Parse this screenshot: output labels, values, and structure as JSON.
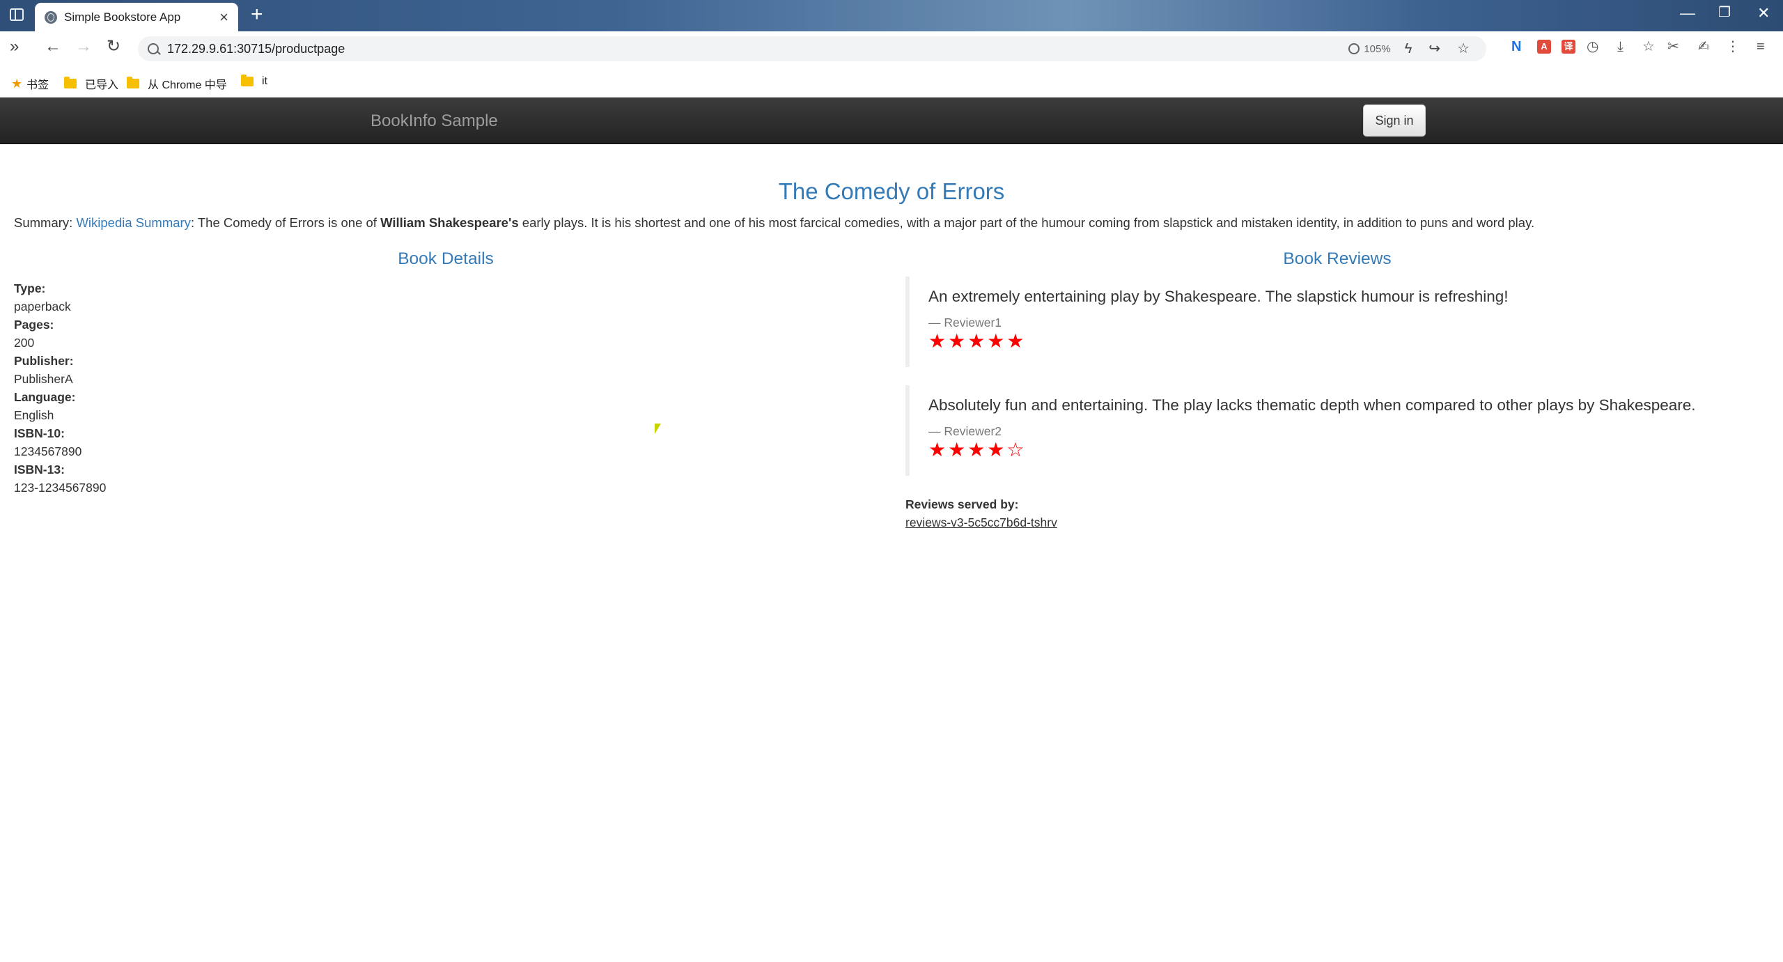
{
  "browser": {
    "tab_title": "Simple Bookstore App",
    "url": "172.29.9.61:30715/productpage",
    "zoom": "105%",
    "bookmarks": [
      {
        "label": "书签"
      },
      {
        "label": "已导入"
      },
      {
        "label": "从 Chrome 中导"
      },
      {
        "label": "it"
      }
    ]
  },
  "navbar": {
    "brand": "BookInfo Sample",
    "signin_label": "Sign in"
  },
  "book": {
    "title": "The Comedy of Errors",
    "summary_prefix": "Summary: ",
    "summary_link": "Wikipedia Summary",
    "summary_mid": ": The Comedy of Errors is one of ",
    "summary_author": "William Shakespeare's",
    "summary_rest": " early plays. It is his shortest and one of his most farcical comedies, with a major part of the humour coming from slapstick and mistaken identity, in addition to puns and word play."
  },
  "details": {
    "heading": "Book Details",
    "fields": [
      {
        "label": "Type:",
        "value": "paperback"
      },
      {
        "label": "Pages:",
        "value": "200"
      },
      {
        "label": "Publisher:",
        "value": "PublisherA"
      },
      {
        "label": "Language:",
        "value": "English"
      },
      {
        "label": "ISBN-10:",
        "value": "1234567890"
      },
      {
        "label": "ISBN-13:",
        "value": "123-1234567890"
      }
    ]
  },
  "reviews": {
    "heading": "Book Reviews",
    "items": [
      {
        "text": "An extremely entertaining play by Shakespeare. The slapstick humour is refreshing!",
        "reviewer": "— Reviewer1",
        "stars": "★★★★★",
        "rating": 5,
        "star_color": "#ff0000"
      },
      {
        "text": "Absolutely fun and entertaining. The play lacks thematic depth when compared to other plays by Shakespeare.",
        "reviewer": "— Reviewer2",
        "stars": "★★★★☆",
        "rating": 4,
        "star_color": "#ff0000"
      }
    ],
    "served_label": "Reviews served by:",
    "served_by": "reviews-v3-5c5cc7b6d-tshrv"
  },
  "colors": {
    "link": "#337ab7",
    "navbar": "#222222",
    "star": "#ff0000"
  }
}
